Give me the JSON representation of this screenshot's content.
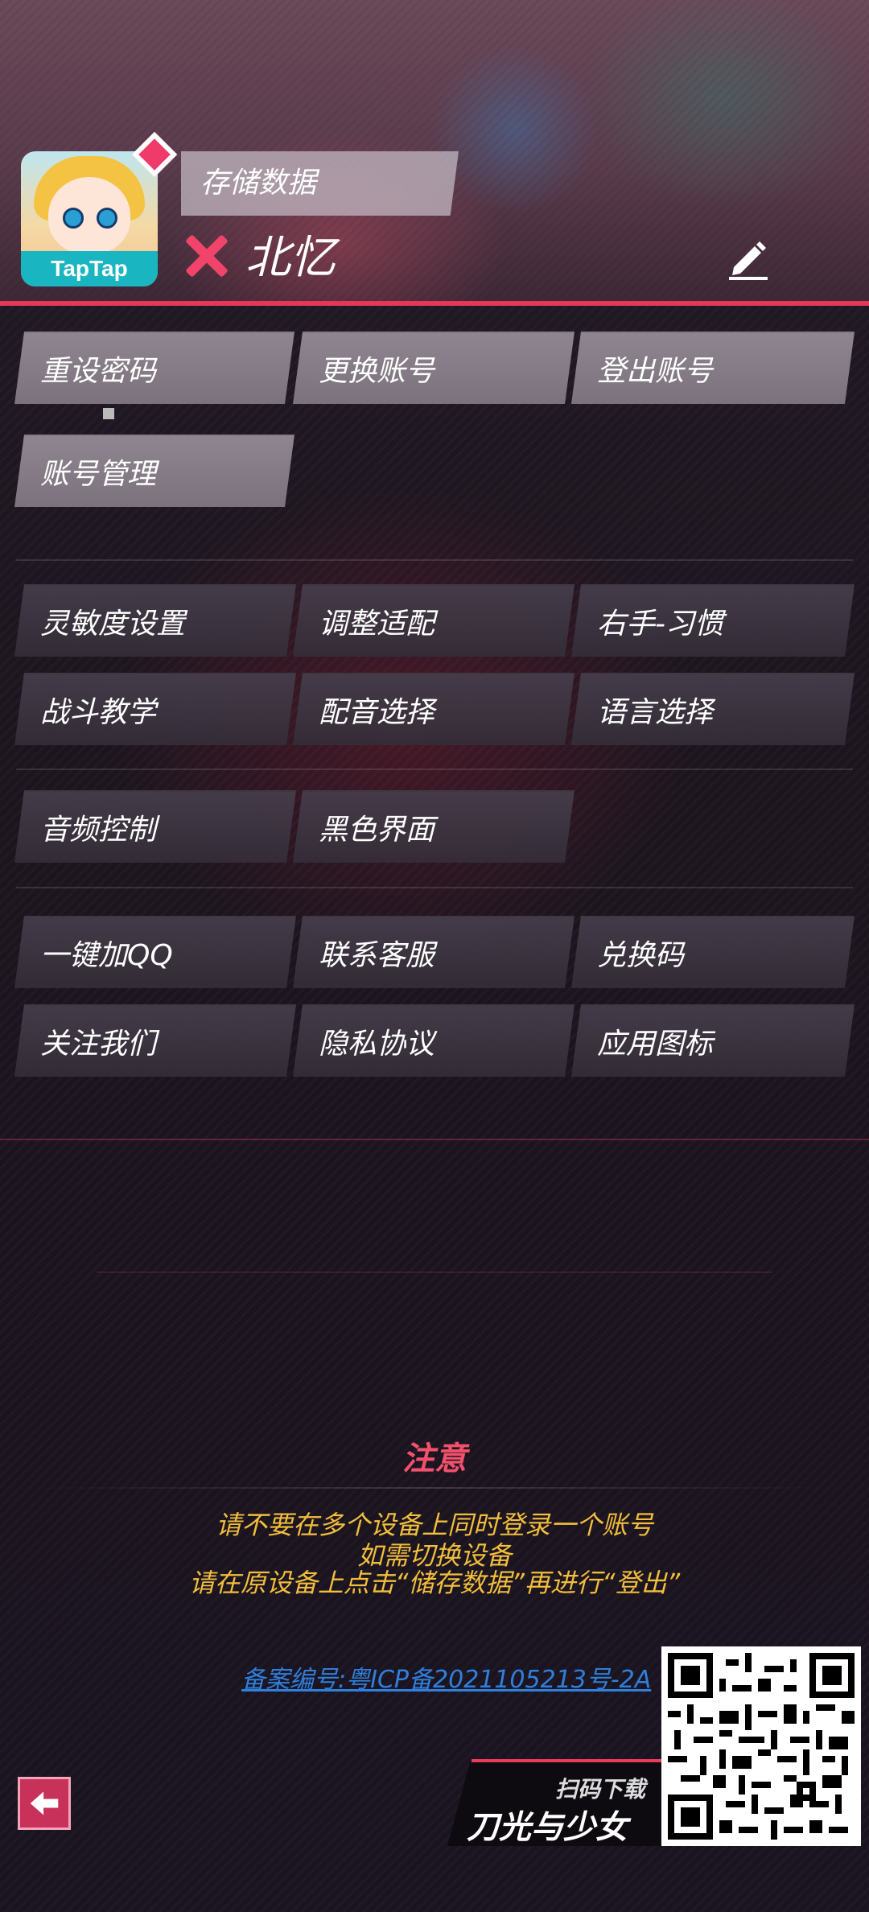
{
  "header": {
    "save_label": "存储数据",
    "username": "北忆",
    "avatar_brand": "TapTap"
  },
  "buttons": {
    "row1": [
      "重设密码",
      "更换账号",
      "登出账号"
    ],
    "row2": [
      "账号管理"
    ],
    "row3": [
      "灵敏度设置",
      "调整适配",
      "右手-习惯"
    ],
    "row4": [
      "战斗教学",
      "配音选择",
      "语言选择"
    ],
    "row5": [
      "音频控制",
      "黑色界面"
    ],
    "row6": [
      "一键加QQ",
      "联系客服",
      "兑换码"
    ],
    "row7": [
      "关注我们",
      "隐私协议",
      "应用图标"
    ]
  },
  "notice": {
    "title": "注意",
    "lines": [
      "请不要在多个设备上同时登录一个账号",
      "如需切换设备",
      "请在原设备上点击“储存数据”再进行“登出”"
    ]
  },
  "icp": "备案编号:粤ICP备2021105213号-2A",
  "promo": {
    "scan_label": "扫码下载",
    "game_title": "刀光与少女"
  },
  "colors": {
    "accent": "#e8355a",
    "notice_text": "#f2be3c",
    "link": "#2f7fdc",
    "button_bg": "#3e3643"
  }
}
